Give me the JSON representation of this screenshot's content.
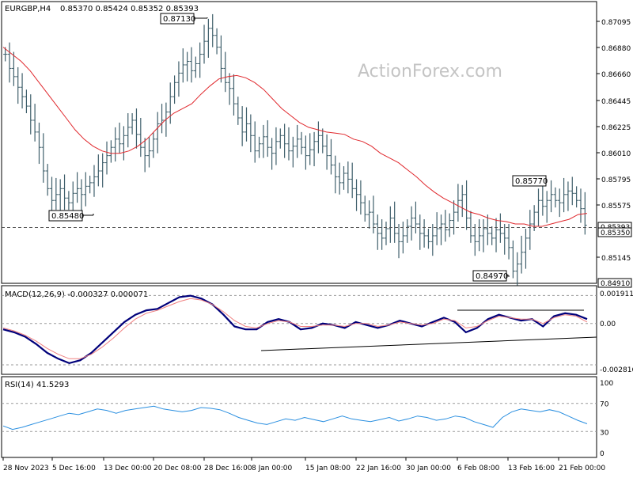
{
  "header": {
    "symbol": "EURGBP,H4",
    "ohlc": "0.85370 0.85424 0.85352 0.85393",
    "watermark": "ActionForex.com"
  },
  "colors": {
    "bars": "#3f5f6b",
    "ma": "#e0282d",
    "macd": "#00007a",
    "signal": "#f08080",
    "rsi": "#2a8fe0",
    "axis": "#000000",
    "grid_dash": "#9a9a9a"
  },
  "chart_data": [
    {
      "type": "ohlc",
      "panel": "price",
      "title": "EURGBP,H4",
      "ylim": [
        0.8491,
        0.8726
      ],
      "y_ticks": [
        "0.87095",
        "0.86880",
        "0.86660",
        "0.86445",
        "0.86225",
        "0.86010",
        "0.85795",
        "0.85575",
        "0.85145"
      ],
      "price_markers": [
        "0.85393",
        "0.85350",
        "0.84910"
      ],
      "annotations": [
        {
          "label": "0.87130",
          "x": "~27 Dec",
          "y": 0.8713
        },
        {
          "label": "0.85480",
          "x": "~4 Dec",
          "y": 0.8548
        },
        {
          "label": "0.85770",
          "x": "~16 Feb",
          "y": 0.8577
        },
        {
          "label": "0.84970",
          "x": "~13 Feb",
          "y": 0.8497
        }
      ],
      "close_series": [
        0.8684,
        0.8672,
        0.8665,
        0.8656,
        0.8648,
        0.864,
        0.8628,
        0.8618,
        0.8605,
        0.8585,
        0.857,
        0.856,
        0.8565,
        0.857,
        0.8562,
        0.8558,
        0.8566,
        0.857,
        0.8565,
        0.8572,
        0.8575,
        0.858,
        0.8585,
        0.8592,
        0.8598,
        0.8605,
        0.8612,
        0.8608,
        0.8615,
        0.8622,
        0.8628,
        0.8616,
        0.8605,
        0.8598,
        0.8602,
        0.8612,
        0.8625,
        0.8628,
        0.8635,
        0.8648,
        0.866,
        0.8668,
        0.8675,
        0.8678,
        0.867,
        0.8676,
        0.8684,
        0.8695,
        0.8706,
        0.87,
        0.869,
        0.8672,
        0.866,
        0.8655,
        0.8642,
        0.863,
        0.8618,
        0.8625,
        0.8615,
        0.8602,
        0.8608,
        0.8614,
        0.8605,
        0.86,
        0.861,
        0.8615,
        0.8608,
        0.8602,
        0.8606,
        0.8612,
        0.8605,
        0.8598,
        0.8603,
        0.861,
        0.8615,
        0.8606,
        0.8598,
        0.859,
        0.858,
        0.8575,
        0.8583,
        0.8578,
        0.857,
        0.8565,
        0.8558,
        0.8548,
        0.855,
        0.854,
        0.8532,
        0.8528,
        0.8536,
        0.8545,
        0.8532,
        0.8525,
        0.853,
        0.8538,
        0.8545,
        0.854,
        0.8532,
        0.853,
        0.8525,
        0.853,
        0.8536,
        0.854,
        0.8535,
        0.8543,
        0.855,
        0.856,
        0.8565,
        0.8545,
        0.853,
        0.8525,
        0.853,
        0.8536,
        0.8532,
        0.8528,
        0.8535,
        0.8532,
        0.8528,
        0.852,
        0.85,
        0.8506,
        0.8516,
        0.8528,
        0.854,
        0.855,
        0.856,
        0.8555,
        0.856,
        0.8565,
        0.856,
        0.8558,
        0.8565,
        0.8568,
        0.8566,
        0.856,
        0.8553,
        0.8539
      ],
      "ma_series": [
        0.869,
        0.8684,
        0.8678,
        0.867,
        0.866,
        0.865,
        0.864,
        0.863,
        0.862,
        0.8612,
        0.8606,
        0.8602,
        0.86,
        0.86,
        0.8602,
        0.8606,
        0.8612,
        0.862,
        0.8628,
        0.8634,
        0.8638,
        0.8642,
        0.865,
        0.8657,
        0.8663,
        0.8665,
        0.8666,
        0.8664,
        0.866,
        0.8654,
        0.8646,
        0.8638,
        0.8632,
        0.8626,
        0.8622,
        0.862,
        0.8618,
        0.8617,
        0.8616,
        0.8612,
        0.861,
        0.8606,
        0.86,
        0.8596,
        0.8592,
        0.8586,
        0.858,
        0.8573,
        0.8567,
        0.8562,
        0.8558,
        0.8554,
        0.855,
        0.8548,
        0.8545,
        0.8543,
        0.8542,
        0.854,
        0.854,
        0.8538,
        0.8538,
        0.854,
        0.8542,
        0.8544,
        0.8548,
        0.8549
      ]
    },
    {
      "type": "line",
      "panel": "macd",
      "title": "MACD(12,26,9) -0.000327 0.000071",
      "ylim": [
        -0.0033,
        0.0022
      ],
      "y_ticks": [
        "0.001911",
        "0.00",
        "-0.002816"
      ],
      "series": [
        {
          "name": "MACD",
          "values": [
            -0.0004,
            -0.0006,
            -0.0009,
            -0.0014,
            -0.002,
            -0.0024,
            -0.0027,
            -0.0025,
            -0.002,
            -0.0013,
            -0.0006,
            0.0001,
            0.0006,
            0.0009,
            0.001,
            0.0014,
            0.0018,
            0.0019,
            0.0017,
            0.0013,
            0.0006,
            -0.0002,
            -0.0004,
            -0.0004,
            0.0001,
            0.0003,
            0.0001,
            -0.0004,
            -0.0003,
            0.0,
            -0.0001,
            -0.0003,
            0.0001,
            -0.0001,
            -0.0003,
            -0.0001,
            0.0002,
            0.0,
            -0.0002,
            0.0001,
            0.0004,
            0.0001,
            -0.0006,
            -0.0003,
            0.0003,
            0.0006,
            0.0004,
            0.0002,
            0.0003,
            -0.0002,
            0.0005,
            0.0007,
            0.0006,
            0.0003
          ]
        },
        {
          "name": "Signal",
          "values": [
            -0.0003,
            -0.0005,
            -0.0008,
            -0.0012,
            -0.0017,
            -0.0021,
            -0.0024,
            -0.0024,
            -0.0021,
            -0.0016,
            -0.001,
            -0.0003,
            0.0003,
            0.0007,
            0.0009,
            0.0012,
            0.0015,
            0.0017,
            0.0016,
            0.0013,
            0.0008,
            0.0002,
            -0.0002,
            -0.0003,
            0.0,
            0.0002,
            0.0001,
            -0.0002,
            -0.0002,
            -0.0001,
            -0.0001,
            -0.0002,
            0.0,
            0.0,
            -0.0002,
            -0.0001,
            0.0001,
            0.0,
            -0.0001,
            0.0,
            0.0003,
            0.0002,
            -0.0003,
            -0.0002,
            0.0002,
            0.0005,
            0.0004,
            0.0003,
            0.0003,
            0.0,
            0.0004,
            0.0006,
            0.0005,
            0.0001
          ]
        }
      ]
    },
    {
      "type": "line",
      "panel": "rsi",
      "title": "RSI(14) 41.5293",
      "ylim": [
        0,
        100
      ],
      "y_ticks": [
        "100",
        "70",
        "30",
        "0"
      ],
      "levels": [
        70,
        30
      ],
      "series": [
        {
          "name": "RSI",
          "values": [
            38,
            33,
            36,
            40,
            44,
            48,
            52,
            56,
            54,
            58,
            62,
            60,
            56,
            60,
            62,
            64,
            66,
            62,
            60,
            58,
            60,
            64,
            63,
            61,
            56,
            50,
            46,
            42,
            40,
            44,
            48,
            46,
            50,
            47,
            44,
            48,
            52,
            48,
            46,
            44,
            47,
            50,
            45,
            48,
            52,
            50,
            46,
            48,
            52,
            50,
            44,
            40,
            36,
            50,
            58,
            62,
            60,
            58,
            61,
            58,
            52,
            46,
            41
          ]
        }
      ]
    }
  ],
  "x_axis": {
    "labels": [
      "28 Nov 2023",
      "5 Dec 16:00",
      "13 Dec 00:00",
      "20 Dec 08:00",
      "28 Dec 16:00",
      "8 Jan 00:00",
      "15 Jan 08:00",
      "22 Jan 16:00",
      "30 Jan 00:00",
      "6 Feb 08:00",
      "13 Feb 16:00",
      "21 Feb 00:00"
    ]
  }
}
